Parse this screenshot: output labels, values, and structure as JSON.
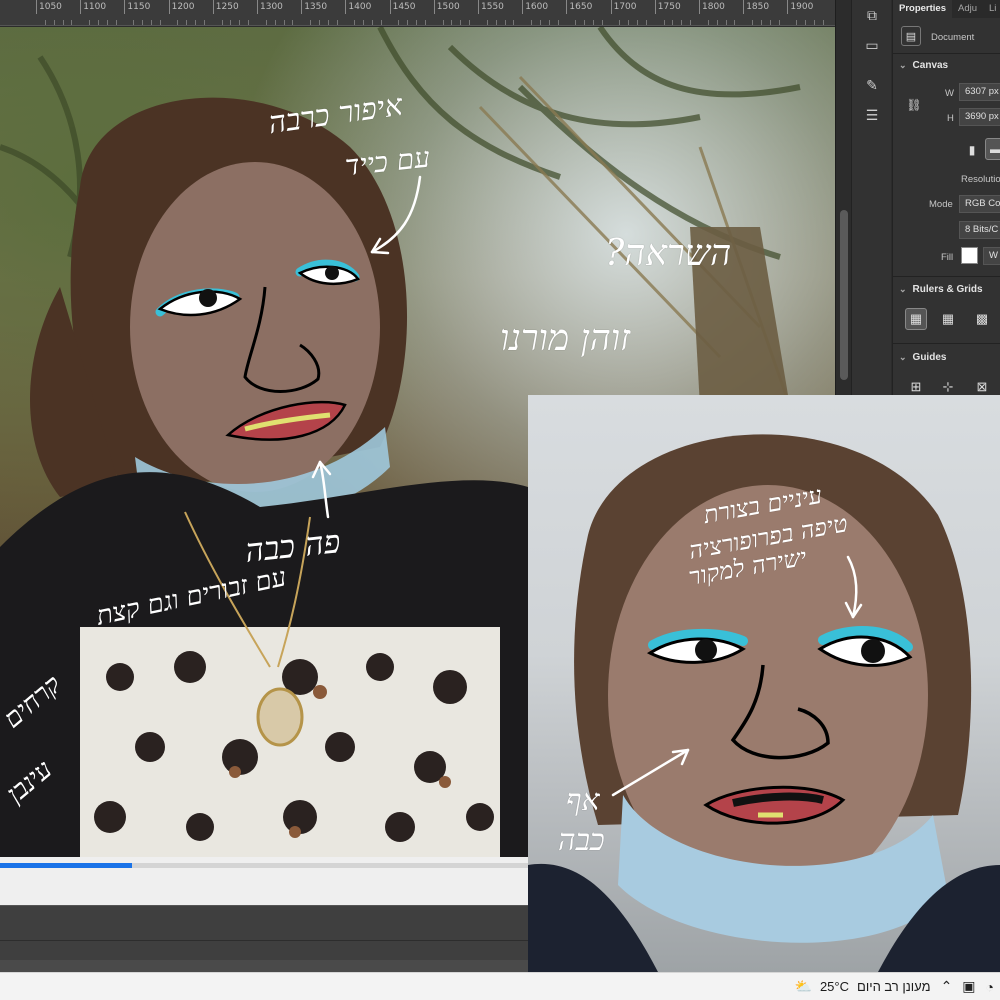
{
  "ruler": {
    "ticks": [
      "1050",
      "1100",
      "1150",
      "1200",
      "1250",
      "1300",
      "1350",
      "1400",
      "1450",
      "1500",
      "1550",
      "1600",
      "1650",
      "1700",
      "1750",
      "1800",
      "1850",
      "1900"
    ]
  },
  "properties_panel": {
    "tabs": [
      "Properties",
      "Adju",
      "Li"
    ],
    "document_label": "Document",
    "canvas": {
      "header": "Canvas",
      "w_label": "W",
      "w_value": "6307 px",
      "h_label": "H",
      "h_value": "3690 px",
      "resolution_label": "Resolution",
      "mode_label": "Mode",
      "mode_value": "RGB Co",
      "bits_value": "8 Bits/C",
      "fill_label": "Fill",
      "fill_value": "W"
    },
    "rulers_grids_header": "Rulers & Grids",
    "guides_header": "Guides"
  },
  "video": {
    "progress": 0.25
  },
  "annotations_photo1": {
    "top_right_line1": "איפור כרבה",
    "top_right_line2": "עם כייד",
    "sky_line1": "השראה?",
    "sky_line2": "זוהן מורנו",
    "mouth_line1": "פה כבה",
    "mouth_line2": "עם זבורים וגם קצת",
    "left_line1": "קרחים",
    "left_line2": "עינבן"
  },
  "annotations_photo2": {
    "top_line1": "עיניים בצורת",
    "top_line2": "טיפה בפרופורציה",
    "top_line3": "ישירה למקור",
    "nose_line1": "אף",
    "nose_line2": "כבה"
  },
  "taskbar": {
    "temperature": "25°C",
    "weather_text": "מעונן רב היום"
  }
}
